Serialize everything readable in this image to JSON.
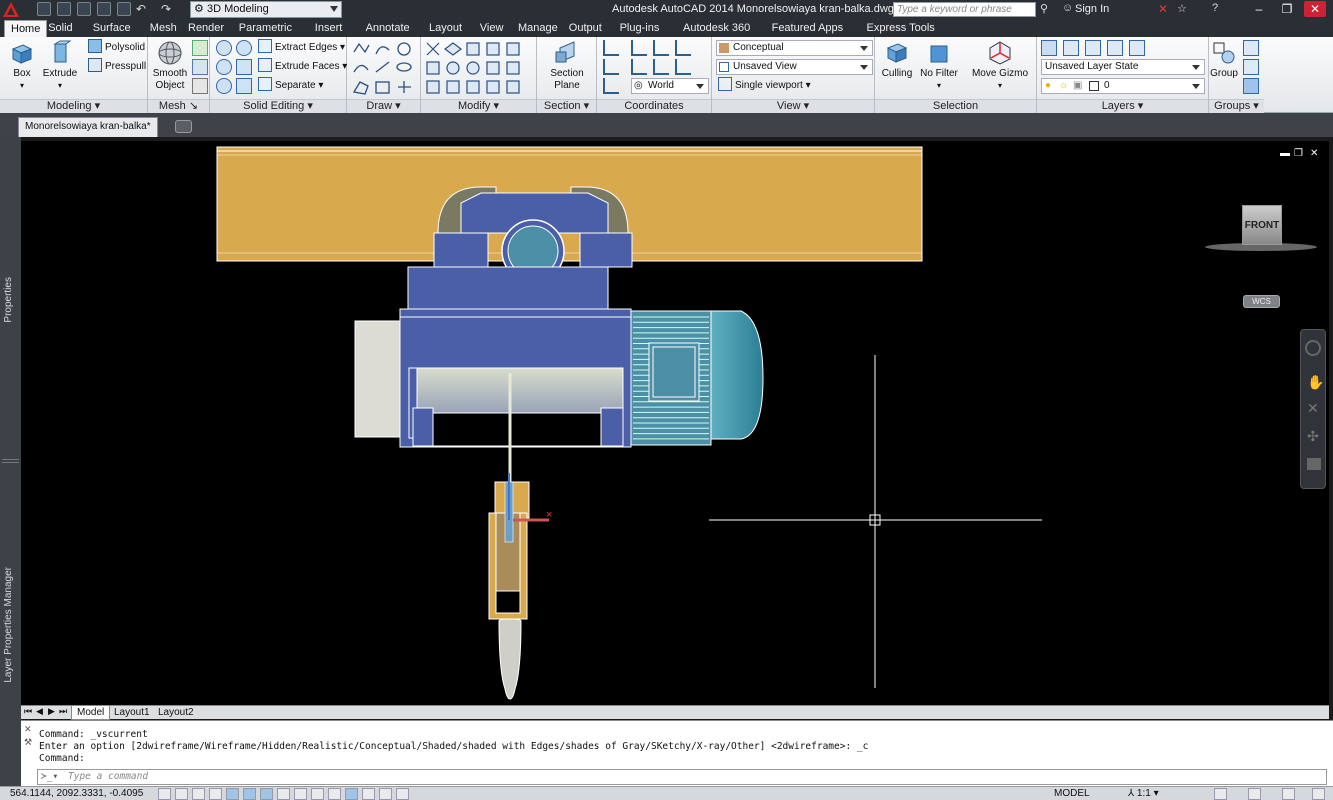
{
  "titlebar": {
    "workspace": "3D Modeling",
    "app_title": "Autodesk AutoCAD 2014    Monorelsowiaya kran-balka.dwg",
    "search_placeholder": "Type a keyword or phrase",
    "sign_in": "Sign In"
  },
  "menu_tabs": [
    "Home",
    "Solid",
    "Surface",
    "Mesh",
    "Render",
    "Parametric",
    "Insert",
    "Annotate",
    "Layout",
    "View",
    "Manage",
    "Output",
    "Plug-ins",
    "Autodesk 360",
    "Featured Apps",
    "Express Tools"
  ],
  "ribbon": {
    "modeling": {
      "title": "Modeling",
      "box": "Box",
      "extrude": "Extrude",
      "polysolid": "Polysolid",
      "presspull": "Presspull"
    },
    "mesh": {
      "title": "Mesh",
      "smooth": "Smooth",
      "object": "Object"
    },
    "solid_editing": {
      "title": "Solid Editing",
      "extract_edges": "Extract Edges",
      "extrude_faces": "Extrude Faces",
      "separate": "Separate"
    },
    "draw": {
      "title": "Draw"
    },
    "modify": {
      "title": "Modify"
    },
    "section": {
      "title": "Section",
      "plane_1": "Section",
      "plane_2": "Plane"
    },
    "coordinates": {
      "title": "Coordinates",
      "world": "World"
    },
    "view": {
      "title": "View",
      "visual_style": "Conceptual",
      "saved_view": "Unsaved View",
      "viewport": "Single viewport"
    },
    "selection": {
      "title": "Selection",
      "culling": "Culling",
      "no_filter": "No Filter",
      "move_gizmo": "Move Gizmo"
    },
    "layers": {
      "title": "Layers",
      "layer_state": "Unsaved Layer State",
      "current_layer": "0"
    },
    "groups": {
      "title": "Groups",
      "group": "Group"
    }
  },
  "document_tab": "Monorelsowiaya kran-balka*",
  "palettes": {
    "properties": "Properties",
    "layer_manager": "Layer Properties Manager"
  },
  "viewport": {
    "viewcube_face": "FRONT",
    "wcs": "WCS"
  },
  "layout_tabs": [
    "Model",
    "Layout1",
    "Layout2"
  ],
  "command_history": [
    "Command: _vscurrent",
    "Enter an option [2dwireframe/Wireframe/Hidden/Realistic/Conceptual/Shaded/shaded with Edges/shades of Gray/SKetchy/X-ray/Other] <2dwireframe>: _c",
    "Command:"
  ],
  "command_placeholder": "Type a command",
  "status": {
    "coordinates": "564.1144, 2092.3331, -0.4095",
    "space": "MODEL",
    "scale": "1:1"
  },
  "colors": {
    "beam": "#d9a94e",
    "hoist": "#4a5fa8",
    "motor": "#3d9aa8",
    "hook": "#e3a64d"
  }
}
